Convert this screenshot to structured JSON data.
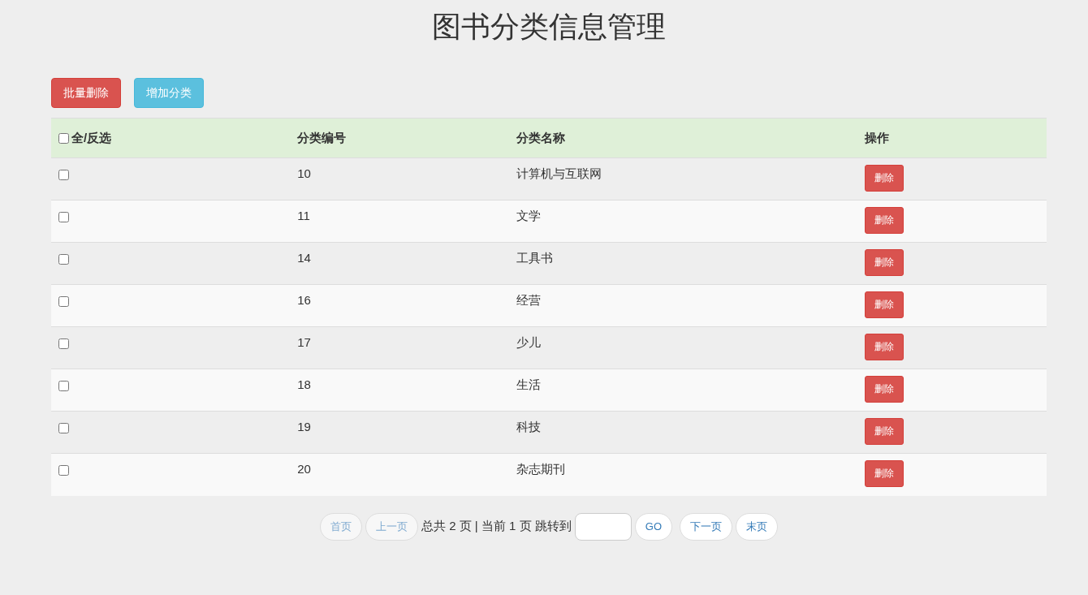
{
  "title": "图书分类信息管理",
  "toolbar": [
    {
      "kind": "danger",
      "label": "批量删除"
    },
    {
      "kind": "info",
      "label": "增加分类"
    }
  ],
  "table": {
    "select_all": {
      "label": "全/反选",
      "checked": false
    },
    "columns": [
      "分类编号",
      "分类名称",
      "操作"
    ],
    "rows": [
      {
        "checked": false,
        "id": "10",
        "name": "计算机与互联网",
        "action": "删除"
      },
      {
        "checked": false,
        "id": "11",
        "name": "文学",
        "action": "删除"
      },
      {
        "checked": false,
        "id": "14",
        "name": "工具书",
        "action": "删除"
      },
      {
        "checked": false,
        "id": "16",
        "name": "经营",
        "action": "删除"
      },
      {
        "checked": false,
        "id": "17",
        "name": "少儿",
        "action": "删除"
      },
      {
        "checked": false,
        "id": "18",
        "name": "生活",
        "action": "删除"
      },
      {
        "checked": false,
        "id": "19",
        "name": "科技",
        "action": "删除"
      },
      {
        "checked": false,
        "id": "20",
        "name": "杂志期刊",
        "action": "删除"
      }
    ]
  },
  "pagination": {
    "first": {
      "label": "首页",
      "disabled": true
    },
    "prev": {
      "label": "上一页",
      "disabled": true
    },
    "summary": "总共 2 页 | 当前 1 页 跳转到",
    "go": "GO",
    "next": {
      "label": "下一页",
      "disabled": false
    },
    "last": {
      "label": "末页",
      "disabled": false
    }
  }
}
